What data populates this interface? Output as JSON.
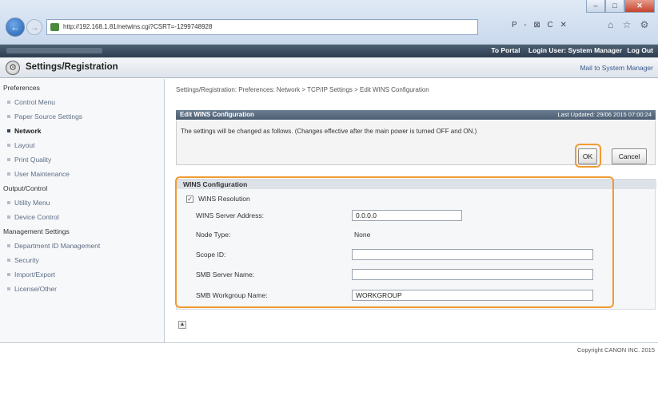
{
  "browser": {
    "url": "http://192.168.1.81/netwins.cgi?CSRT=-1299748928",
    "search_tools": "P - ⊠ C ✕",
    "icons": "⌂ ☆ ⚙"
  },
  "topbar": {
    "portal_link": "To Portal",
    "login_user": "Login User: System Manager",
    "logout": "Log Out"
  },
  "header": {
    "title": "Settings/Registration",
    "mail_link": "Mail to System Manager"
  },
  "sidebar": {
    "sections": [
      {
        "label": "Preferences",
        "items": [
          "Control Menu",
          "Paper Source Settings",
          "Network",
          "Layout",
          "Print Quality",
          "User Maintenance"
        ]
      },
      {
        "label": "Output/Control",
        "items": [
          "Utility Menu",
          "Device Control"
        ]
      },
      {
        "label": "Management Settings",
        "items": [
          "Department ID Management",
          "Security",
          "Import/Export",
          "License/Other"
        ]
      }
    ],
    "active_item": "Network"
  },
  "main": {
    "breadcrumb": "Settings/Registration: Preferences: Network > TCP/IP Settings > Edit WINS Configuration",
    "edit_title": "Edit WINS Configuration",
    "last_updated": "Last Updated: 29/06 2015 07:00:24",
    "message": "The settings will be changed as follows. (Changes effective after the main power is turned OFF and ON.)",
    "ok_label": "OK",
    "cancel_label": "Cancel",
    "wins": {
      "heading": "WINS Configuration",
      "resolution_label": "WINS Resolution",
      "resolution_checked": true,
      "server_address_label": "WINS Server Address:",
      "server_address_value": "0.0.0.0",
      "node_type_label": "Node Type:",
      "node_type_value": "None",
      "scope_id_label": "Scope ID:",
      "scope_id_value": "",
      "smb_server_label": "SMB Server Name:",
      "smb_server_value": "",
      "smb_workgroup_label": "SMB Workgroup Name:",
      "smb_workgroup_value": "WORKGROUP"
    }
  },
  "footer": {
    "copyright": "Copyright CANON INC. 2015"
  },
  "colors": {
    "highlight": "#f19a31",
    "title_bar": "#4c5d72"
  }
}
